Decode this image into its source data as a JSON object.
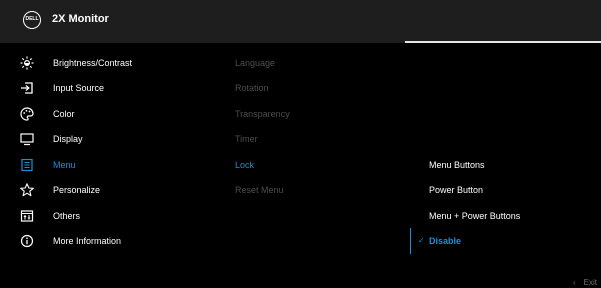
{
  "header": {
    "logo_text": "DELL",
    "title": "2X Monitor"
  },
  "main_menu": [
    {
      "label": "Brightness/Contrast",
      "icon": "brightness-icon"
    },
    {
      "label": "Input Source",
      "icon": "input-source-icon"
    },
    {
      "label": "Color",
      "icon": "color-palette-icon"
    },
    {
      "label": "Display",
      "icon": "display-icon"
    },
    {
      "label": "Menu",
      "icon": "menu-icon",
      "active": true
    },
    {
      "label": "Personalize",
      "icon": "star-icon"
    },
    {
      "label": "Others",
      "icon": "others-icon"
    },
    {
      "label": "More Information",
      "icon": "info-icon"
    }
  ],
  "sub_menu": [
    {
      "label": "Language"
    },
    {
      "label": "Rotation"
    },
    {
      "label": "Transparency"
    },
    {
      "label": "Timer"
    },
    {
      "label": "Lock",
      "active": true
    },
    {
      "label": "Reset Menu"
    }
  ],
  "lock_options": [
    {
      "label": "Menu Buttons"
    },
    {
      "label": "Power Button"
    },
    {
      "label": "Menu + Power Buttons"
    },
    {
      "label": "Disable",
      "selected": true,
      "check": "✓"
    }
  ],
  "footer": {
    "chevron": "‹",
    "exit_label": "Exit"
  },
  "colors": {
    "accent": "#1a8fd9",
    "header_bg": "#1e1e1e",
    "background": "#000000",
    "disabled_text": "#4d4d4d"
  }
}
